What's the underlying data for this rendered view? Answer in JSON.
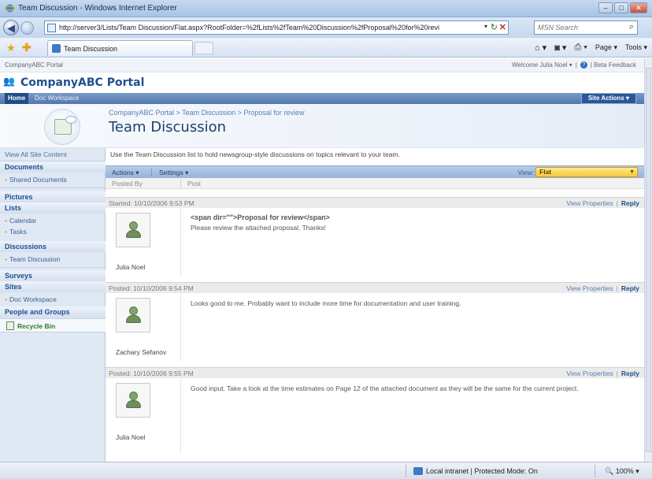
{
  "browser": {
    "window_title": "Team Discussion - Windows Internet Explorer",
    "url": "http://server3/Lists/Team Discussion/Flat.aspx?RootFolder=%2fLists%2fTeam%20Discussion%2fProposal%20for%20revi",
    "search_placeholder": "MSN Search",
    "tab_title": "Team Discussion",
    "page_menu": "Page ▾",
    "tools_menu": "Tools ▾",
    "status_zone": "Local intranet | Protected Mode: On",
    "zoom": "100%"
  },
  "sharepoint": {
    "portal_link": "CompanyABC Portal",
    "welcome": "Welcome Julia Noel ▾",
    "beta_feedback": "| Beta Feedback",
    "site_title": "CompanyABC Portal",
    "tabs": {
      "home": "Home",
      "doc_workspace": "Doc Workspace"
    },
    "site_actions": "Site Actions ▾",
    "breadcrumb": "CompanyABC Portal > Team Discussion > Proposal for review",
    "page_title": "Team Discussion",
    "quick_launch": {
      "view_all": "View All Site Content",
      "documents_header": "Documents",
      "shared_documents": "Shared Documents",
      "pictures_header": "Pictures",
      "lists_header": "Lists",
      "calendar": "Calendar",
      "tasks": "Tasks",
      "discussions_header": "Discussions",
      "team_discussion": "Team Discussion",
      "surveys_header": "Surveys",
      "sites_header": "Sites",
      "doc_workspace": "Doc Workspace",
      "people_header": "People and Groups",
      "recycle_bin": "Recycle Bin"
    },
    "description": "Use the Team Discussion list to hold newsgroup-style discussions on topics relevant to your team.",
    "toolbar": {
      "actions": "Actions ▾",
      "settings": "Settings ▾",
      "view_label": "View:",
      "view_value": "Flat"
    },
    "columns": {
      "posted_by": "Posted By",
      "post": "Post"
    },
    "posts": [
      {
        "started": "Started: 10/10/2006 9:53 PM",
        "view_properties": "View Properties",
        "reply": "Reply",
        "author": "Julia Noel",
        "subject": "<span dir=\"\">Proposal for review</span>",
        "body": "Please review the attached proposal. Thanks!"
      },
      {
        "started": "Posted: 10/10/2006 9:54 PM",
        "view_properties": "View Properties",
        "reply": "Reply",
        "author": "Zachary Sefanov",
        "subject": "",
        "body": "Looks good to me.  Probably want to include more time for documentation and user training."
      },
      {
        "started": "Posted: 10/10/2006 9:55 PM",
        "view_properties": "View Properties",
        "reply": "Reply",
        "author": "Julia Noel",
        "subject": "",
        "body": "Good input. Take a look at the time estimates on Page 12 of the attached document as they will be the same for the current project."
      }
    ]
  }
}
